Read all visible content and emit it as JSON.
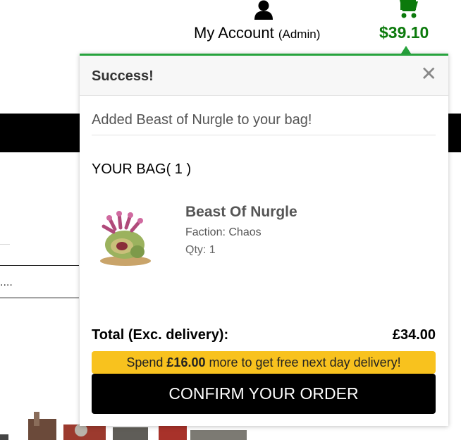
{
  "header": {
    "account_label": "My Account",
    "account_role": "(Admin)",
    "cart_total": "$39.10",
    "cart_total_color": "#0c7a0c"
  },
  "page_fragments": {
    "truncated_text": "...."
  },
  "popover": {
    "accent_color": "#27a33d",
    "title": "Success!",
    "close_label": "✕",
    "message": "Added Beast of Nurgle to your bag!",
    "bag_title": "YOUR BAG( 1 )",
    "item": {
      "name": "Beast Of Nurgle",
      "faction": "Faction: Chaos",
      "qty": "Qty: 1",
      "image_icon": "miniature-figure-image"
    },
    "total_label": "Total (Exc. delivery):",
    "total_value": "£34.00",
    "promo": {
      "prefix": "Spend ",
      "amount": "£16.00",
      "suffix": " more to get free next day delivery!",
      "color": "#f8c21e"
    },
    "confirm_label": "CONFIRM YOUR ORDER"
  }
}
